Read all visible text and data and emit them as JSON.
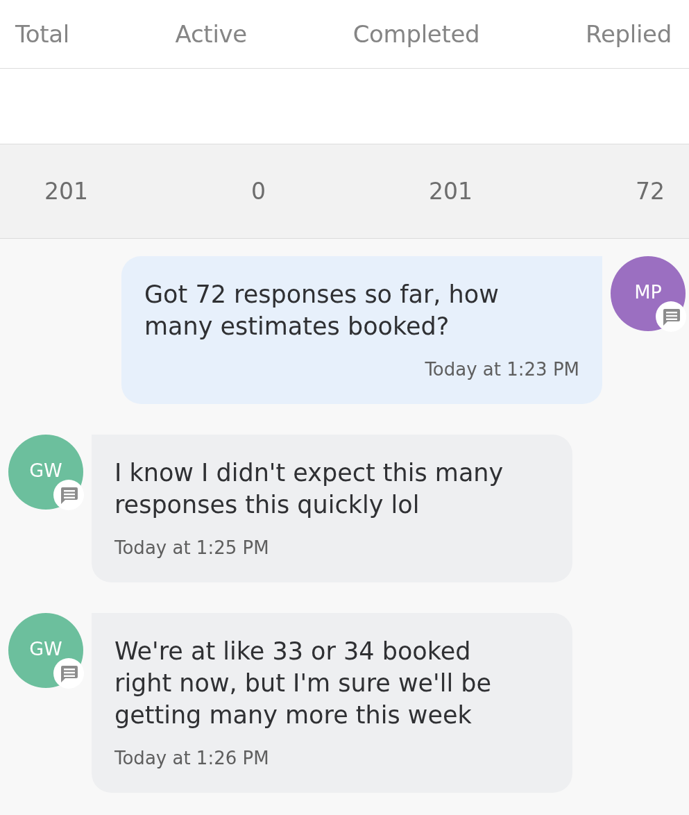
{
  "stats": {
    "columns": [
      "Total",
      "Active",
      "Completed",
      "Replied"
    ],
    "values": [
      "201",
      "0",
      "201",
      "72"
    ]
  },
  "messages": [
    {
      "kind": "outgoing",
      "avatar": {
        "initials": "MP",
        "color": "#9b6fc1"
      },
      "text": "Got 72 responses so far, how many estimates booked?",
      "time": "Today at 1:23 PM"
    },
    {
      "kind": "incoming",
      "avatar": {
        "initials": "GW",
        "color": "#6cbf9d"
      },
      "text": "I know I didn't expect this many responses this quickly lol",
      "time": "Today at 1:25 PM"
    },
    {
      "kind": "incoming",
      "avatar": {
        "initials": "GW",
        "color": "#6cbf9d"
      },
      "text": "We're at like 33 or 34 booked right now, but I'm sure we'll be getting many more this week",
      "time": "Today at 1:26 PM"
    }
  ]
}
